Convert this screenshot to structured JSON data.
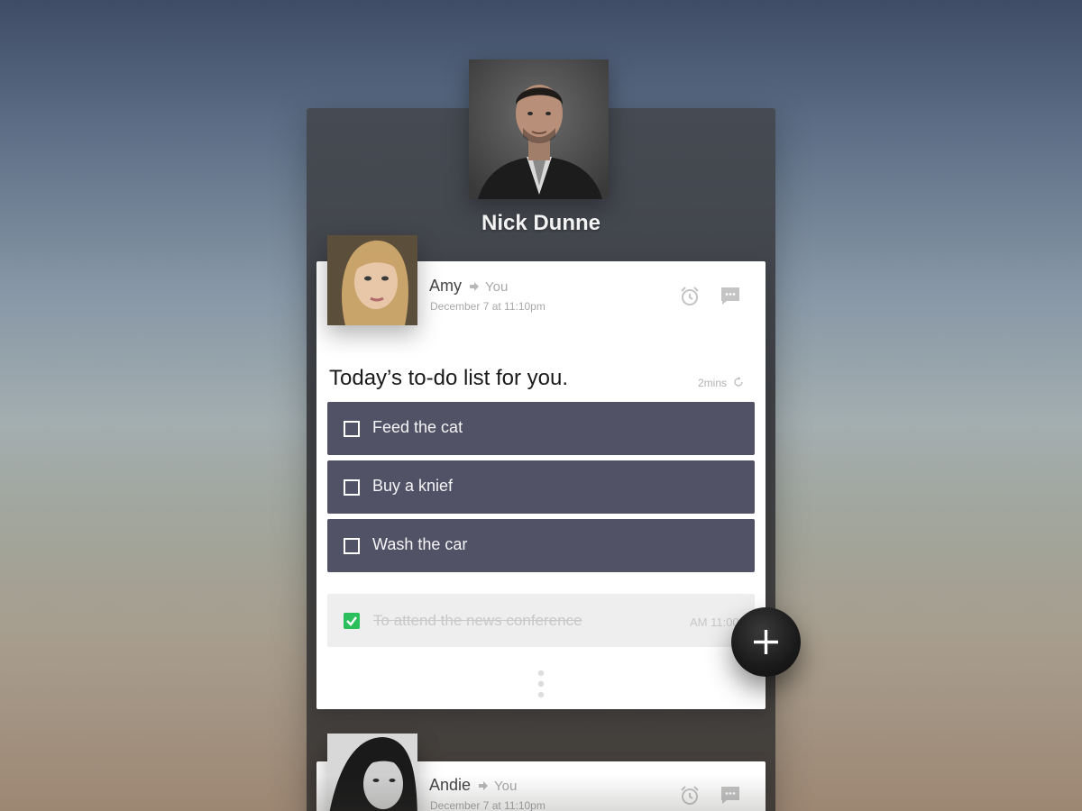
{
  "profile": {
    "name": "Nick Dunne",
    "photo_icon": "person-portrait-icon"
  },
  "messages": [
    {
      "sender": "Amy",
      "recipient": "You",
      "timestamp": "December 7 at 11:10pm",
      "actions": [
        "alarm-icon",
        "comment-icon"
      ],
      "todo": {
        "title": "Today’s to-do list for you.",
        "age": "2mins",
        "open_tasks": [
          {
            "label": "Feed the cat",
            "done": false
          },
          {
            "label": "Buy a knief",
            "done": false
          },
          {
            "label": "Wash the car",
            "done": false
          }
        ],
        "completed_task": {
          "label": "To attend the news conference",
          "time": "AM 11:00",
          "done": true
        }
      }
    },
    {
      "sender": "Andie",
      "recipient": "You",
      "timestamp": "December 7 at 11:10pm",
      "actions": [
        "alarm-icon",
        "comment-icon"
      ]
    }
  ],
  "fab": {
    "icon": "plus-icon"
  },
  "colors": {
    "task_bg": "#525266",
    "done_bg": "#eeeeee",
    "check_green": "#2bbf5b",
    "fab_bg": "#1a1a1a"
  }
}
